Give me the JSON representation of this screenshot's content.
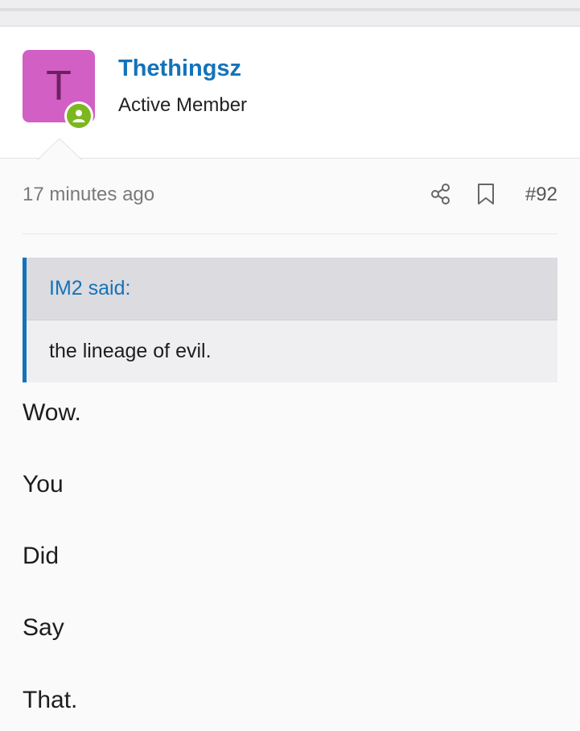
{
  "post": {
    "author": {
      "initial": "T",
      "name": "Thethingsz",
      "title": "Active Member"
    },
    "timestamp": "17 minutes ago",
    "post_number": "#92",
    "quote": {
      "attribution": "IM2 said:",
      "text": "the lineage of evil."
    },
    "body_lines": [
      "Wow.",
      "You",
      "Did",
      "Say",
      "That."
    ]
  },
  "icons": {
    "online": "user-online-icon",
    "share": "share-icon",
    "bookmark": "bookmark-icon"
  },
  "colors": {
    "avatar_bg": "#d25fc4",
    "link": "#1473b8",
    "online": "#7cb71f",
    "quote_bar": "#1473b8"
  }
}
